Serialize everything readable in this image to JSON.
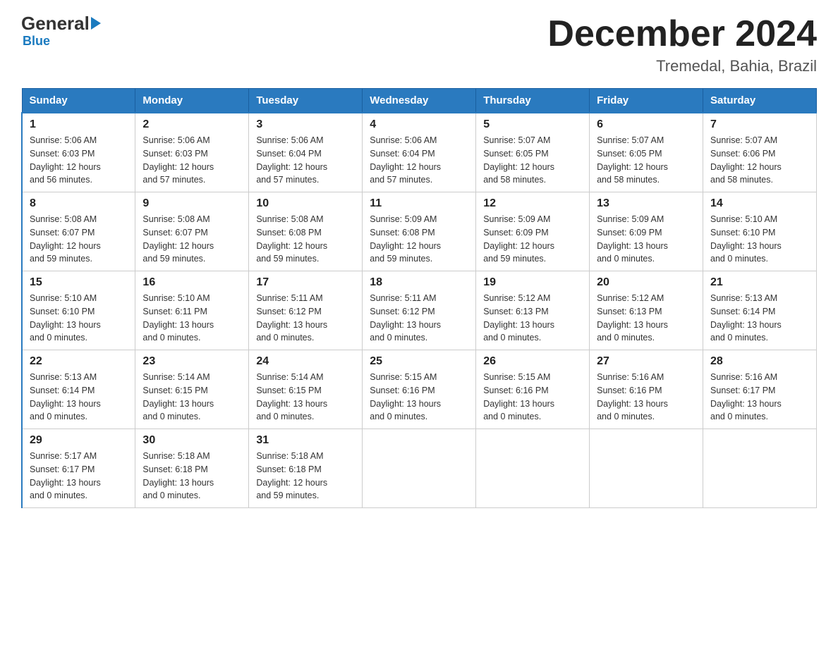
{
  "logo": {
    "general": "General",
    "blue": "Blue"
  },
  "title": "December 2024",
  "subtitle": "Tremedal, Bahia, Brazil",
  "days_of_week": [
    "Sunday",
    "Monday",
    "Tuesday",
    "Wednesday",
    "Thursday",
    "Friday",
    "Saturday"
  ],
  "weeks": [
    [
      {
        "day": "1",
        "sunrise": "5:06 AM",
        "sunset": "6:03 PM",
        "daylight": "12 hours and 56 minutes."
      },
      {
        "day": "2",
        "sunrise": "5:06 AM",
        "sunset": "6:03 PM",
        "daylight": "12 hours and 57 minutes."
      },
      {
        "day": "3",
        "sunrise": "5:06 AM",
        "sunset": "6:04 PM",
        "daylight": "12 hours and 57 minutes."
      },
      {
        "day": "4",
        "sunrise": "5:06 AM",
        "sunset": "6:04 PM",
        "daylight": "12 hours and 57 minutes."
      },
      {
        "day": "5",
        "sunrise": "5:07 AM",
        "sunset": "6:05 PM",
        "daylight": "12 hours and 58 minutes."
      },
      {
        "day": "6",
        "sunrise": "5:07 AM",
        "sunset": "6:05 PM",
        "daylight": "12 hours and 58 minutes."
      },
      {
        "day": "7",
        "sunrise": "5:07 AM",
        "sunset": "6:06 PM",
        "daylight": "12 hours and 58 minutes."
      }
    ],
    [
      {
        "day": "8",
        "sunrise": "5:08 AM",
        "sunset": "6:07 PM",
        "daylight": "12 hours and 59 minutes."
      },
      {
        "day": "9",
        "sunrise": "5:08 AM",
        "sunset": "6:07 PM",
        "daylight": "12 hours and 59 minutes."
      },
      {
        "day": "10",
        "sunrise": "5:08 AM",
        "sunset": "6:08 PM",
        "daylight": "12 hours and 59 minutes."
      },
      {
        "day": "11",
        "sunrise": "5:09 AM",
        "sunset": "6:08 PM",
        "daylight": "12 hours and 59 minutes."
      },
      {
        "day": "12",
        "sunrise": "5:09 AM",
        "sunset": "6:09 PM",
        "daylight": "12 hours and 59 minutes."
      },
      {
        "day": "13",
        "sunrise": "5:09 AM",
        "sunset": "6:09 PM",
        "daylight": "13 hours and 0 minutes."
      },
      {
        "day": "14",
        "sunrise": "5:10 AM",
        "sunset": "6:10 PM",
        "daylight": "13 hours and 0 minutes."
      }
    ],
    [
      {
        "day": "15",
        "sunrise": "5:10 AM",
        "sunset": "6:10 PM",
        "daylight": "13 hours and 0 minutes."
      },
      {
        "day": "16",
        "sunrise": "5:10 AM",
        "sunset": "6:11 PM",
        "daylight": "13 hours and 0 minutes."
      },
      {
        "day": "17",
        "sunrise": "5:11 AM",
        "sunset": "6:12 PM",
        "daylight": "13 hours and 0 minutes."
      },
      {
        "day": "18",
        "sunrise": "5:11 AM",
        "sunset": "6:12 PM",
        "daylight": "13 hours and 0 minutes."
      },
      {
        "day": "19",
        "sunrise": "5:12 AM",
        "sunset": "6:13 PM",
        "daylight": "13 hours and 0 minutes."
      },
      {
        "day": "20",
        "sunrise": "5:12 AM",
        "sunset": "6:13 PM",
        "daylight": "13 hours and 0 minutes."
      },
      {
        "day": "21",
        "sunrise": "5:13 AM",
        "sunset": "6:14 PM",
        "daylight": "13 hours and 0 minutes."
      }
    ],
    [
      {
        "day": "22",
        "sunrise": "5:13 AM",
        "sunset": "6:14 PM",
        "daylight": "13 hours and 0 minutes."
      },
      {
        "day": "23",
        "sunrise": "5:14 AM",
        "sunset": "6:15 PM",
        "daylight": "13 hours and 0 minutes."
      },
      {
        "day": "24",
        "sunrise": "5:14 AM",
        "sunset": "6:15 PM",
        "daylight": "13 hours and 0 minutes."
      },
      {
        "day": "25",
        "sunrise": "5:15 AM",
        "sunset": "6:16 PM",
        "daylight": "13 hours and 0 minutes."
      },
      {
        "day": "26",
        "sunrise": "5:15 AM",
        "sunset": "6:16 PM",
        "daylight": "13 hours and 0 minutes."
      },
      {
        "day": "27",
        "sunrise": "5:16 AM",
        "sunset": "6:16 PM",
        "daylight": "13 hours and 0 minutes."
      },
      {
        "day": "28",
        "sunrise": "5:16 AM",
        "sunset": "6:17 PM",
        "daylight": "13 hours and 0 minutes."
      }
    ],
    [
      {
        "day": "29",
        "sunrise": "5:17 AM",
        "sunset": "6:17 PM",
        "daylight": "13 hours and 0 minutes."
      },
      {
        "day": "30",
        "sunrise": "5:18 AM",
        "sunset": "6:18 PM",
        "daylight": "13 hours and 0 minutes."
      },
      {
        "day": "31",
        "sunrise": "5:18 AM",
        "sunset": "6:18 PM",
        "daylight": "12 hours and 59 minutes."
      },
      null,
      null,
      null,
      null
    ]
  ],
  "labels": {
    "sunrise": "Sunrise:",
    "sunset": "Sunset:",
    "daylight": "Daylight:"
  }
}
